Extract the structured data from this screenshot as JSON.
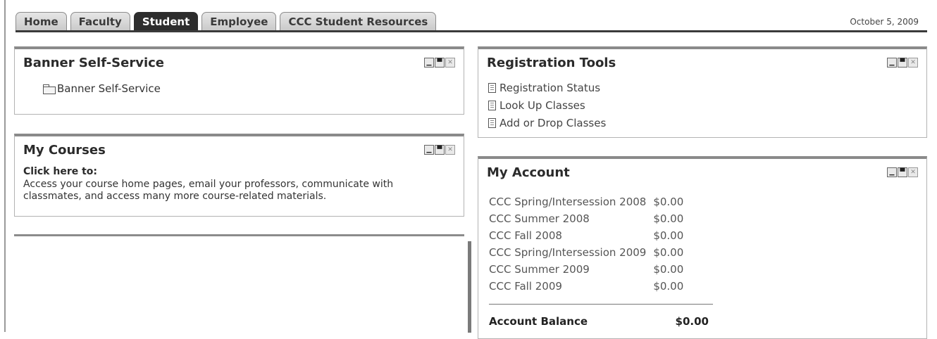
{
  "tabs": [
    {
      "label": "Home"
    },
    {
      "label": "Faculty"
    },
    {
      "label": "Student"
    },
    {
      "label": "Employee"
    },
    {
      "label": "CCC Student Resources"
    }
  ],
  "active_tab": "Student",
  "date": "October 5, 2009",
  "controls": {
    "minimize": "▁",
    "maximize": "▀",
    "close": "✕"
  },
  "banner": {
    "title": "Banner Self-Service",
    "link_label": "Banner Self-Service",
    "icon": "folder-icon"
  },
  "courses": {
    "title": "My Courses",
    "link_label": "Click here to:",
    "description": "Access your course home pages, email your professors, communicate with classmates, and access many more course-related materials."
  },
  "registration": {
    "title": "Registration Tools",
    "links": [
      {
        "label": "Registration Status",
        "icon": "document-icon"
      },
      {
        "label": "Look Up Classes",
        "icon": "document-icon"
      },
      {
        "label": "Add or Drop Classes",
        "icon": "document-icon"
      }
    ]
  },
  "account": {
    "title": "My Account",
    "rows": [
      {
        "term": "CCC Spring/Intersession 2008",
        "amount": "$0.00"
      },
      {
        "term": "CCC Summer 2008",
        "amount": "$0.00"
      },
      {
        "term": "CCC Fall 2008",
        "amount": "$0.00"
      },
      {
        "term": "CCC Spring/Intersession 2009",
        "amount": "$0.00"
      },
      {
        "term": "CCC Summer 2009",
        "amount": "$0.00"
      },
      {
        "term": "CCC Fall 2009",
        "amount": "$0.00"
      }
    ],
    "balance_label": "Account Balance",
    "balance_value": "$0.00"
  }
}
